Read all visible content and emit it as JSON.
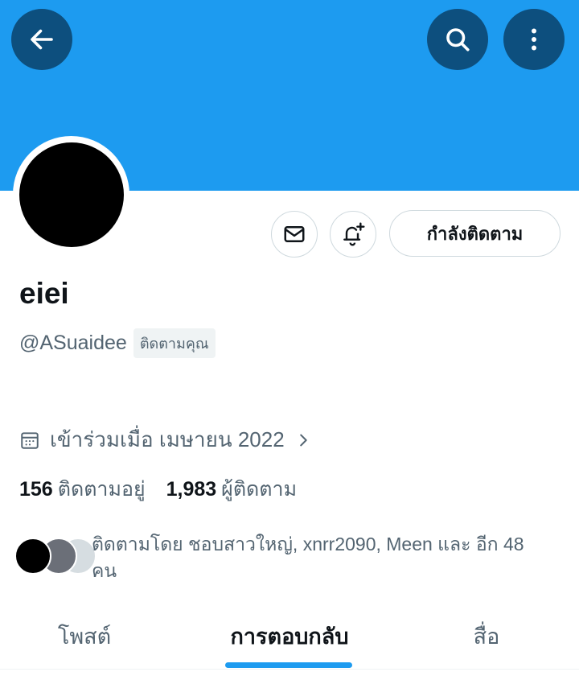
{
  "header": {
    "back_icon": "arrow-left-icon",
    "search_icon": "search-icon",
    "more_icon": "more-vertical-icon",
    "banner_color": "#1d9bf0",
    "button_color": "#0d4f7e"
  },
  "profile": {
    "display_name": "eiei",
    "handle": "@ASuaidee",
    "follows_you": "ติดตามคุณ",
    "joined": "เข้าร่วมเมื่อ เมษายน 2022",
    "following_count": "156",
    "following_label": "ติดตามอยู่",
    "followers_count": "1,983",
    "followers_label": "ผู้ติดตาม",
    "followed_by_text": "ติดตามโดย ชอบสาวใหญ่, xnrr2090, Meen และ อีก 48 คน"
  },
  "actions": {
    "message_icon": "mail-icon",
    "notify_icon": "bell-plus-icon",
    "following_button": "กำลังติดตาม"
  },
  "tabs": [
    {
      "label": "โพสต์",
      "active": false
    },
    {
      "label": "การตอบกลับ",
      "active": true
    },
    {
      "label": "สื่อ",
      "active": false
    }
  ],
  "colors": {
    "accent": "#1d9bf0",
    "text_primary": "#0f1419",
    "text_secondary": "#536471"
  }
}
